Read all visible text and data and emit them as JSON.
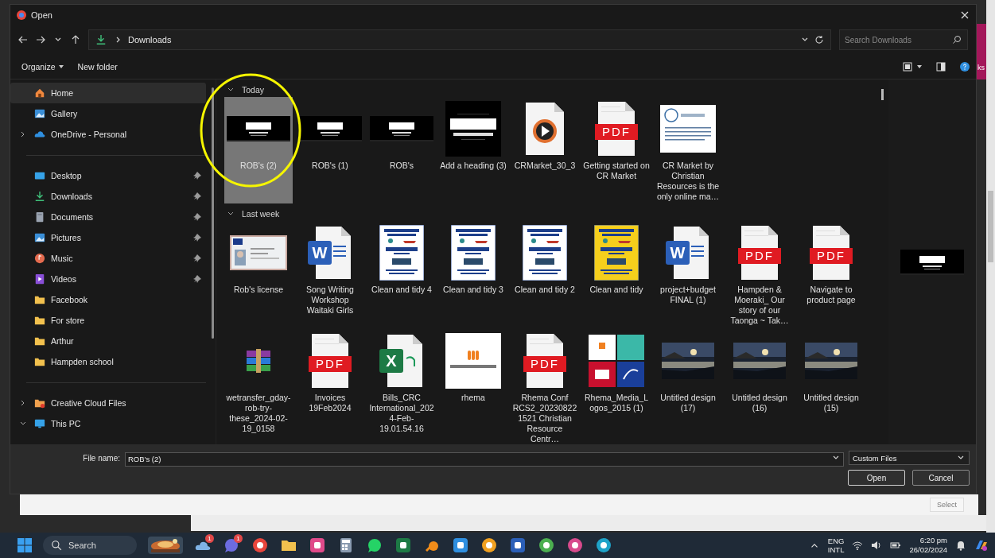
{
  "background_window": {
    "side_text": "ks",
    "button": {
      "label": "Select",
      "disabled": true
    }
  },
  "dialog": {
    "title": "Open",
    "nav": {
      "path": [
        "Downloads"
      ],
      "search": {
        "placeholder": "Search Downloads"
      }
    },
    "toolbar": {
      "buttons": [
        {
          "label": "Organize",
          "menu": true
        },
        {
          "label": "New folder",
          "menu": false
        }
      ]
    },
    "sidebar": {
      "groups": [
        [
          {
            "label": "Home",
            "kind": "home",
            "expandable": false,
            "pinned": false,
            "selected": true
          },
          {
            "label": "Gallery",
            "kind": "gallery",
            "expandable": false,
            "pinned": false,
            "selected": false
          },
          {
            "label": "OneDrive - Personal",
            "kind": "cloud",
            "expandable": true,
            "expanded": false,
            "pinned": false,
            "selected": false
          }
        ],
        [
          {
            "label": "Desktop",
            "kind": "desktop",
            "expandable": false,
            "pinned": true,
            "selected": false
          },
          {
            "label": "Downloads",
            "kind": "download",
            "expandable": false,
            "pinned": true,
            "selected": false
          },
          {
            "label": "Documents",
            "kind": "document",
            "expandable": false,
            "pinned": true,
            "selected": false
          },
          {
            "label": "Pictures",
            "kind": "gallery",
            "expandable": false,
            "pinned": true,
            "selected": false
          },
          {
            "label": "Music",
            "kind": "music",
            "expandable": false,
            "pinned": true,
            "selected": false
          },
          {
            "label": "Videos",
            "kind": "video",
            "expandable": false,
            "pinned": true,
            "selected": false
          },
          {
            "label": "Facebook",
            "kind": "folder",
            "expandable": false,
            "pinned": false,
            "selected": false
          },
          {
            "label": "For store",
            "kind": "folder",
            "expandable": false,
            "pinned": false,
            "selected": false
          },
          {
            "label": "Arthur",
            "kind": "folder",
            "expandable": false,
            "pinned": false,
            "selected": false
          },
          {
            "label": "Hampden school",
            "kind": "folder",
            "expandable": false,
            "pinned": false,
            "selected": false
          }
        ],
        [
          {
            "label": "Creative Cloud Files",
            "kind": "cc",
            "expandable": true,
            "expanded": false,
            "pinned": false,
            "selected": false
          },
          {
            "label": "This PC",
            "kind": "pc",
            "expandable": true,
            "expanded": true,
            "pinned": false,
            "selected": false
          }
        ]
      ]
    },
    "files": {
      "groups": [
        {
          "label": "Today",
          "expanded": true,
          "items": [
            {
              "name": "ROB's (2)",
              "kind": "banner",
              "selected": true
            },
            {
              "name": "ROB's (1)",
              "kind": "banner",
              "selected": false
            },
            {
              "name": "ROB's",
              "kind": "banner",
              "selected": false
            },
            {
              "name": "Add a heading (3)",
              "kind": "square-banner",
              "selected": false
            },
            {
              "name": "CRMarket_30_3",
              "kind": "video",
              "selected": false
            },
            {
              "name": "Getting started on CR Market",
              "kind": "pdf",
              "icon_text": "PDF",
              "selected": false
            },
            {
              "name": "CR Market by Christian Resources is the only online ma…",
              "kind": "page",
              "selected": false
            }
          ]
        },
        {
          "label": "Last week",
          "expanded": true,
          "items": [
            {
              "name": "Rob's license",
              "kind": "card",
              "selected": false
            },
            {
              "name": "Song Writing Workshop Waitaki Girls",
              "kind": "word",
              "icon_text": "W",
              "selected": false
            },
            {
              "name": "Clean and tidy 4",
              "kind": "poster",
              "color": "#ffffff",
              "selected": false
            },
            {
              "name": "Clean and tidy 3",
              "kind": "poster",
              "color": "#ffffff",
              "selected": false
            },
            {
              "name": "Clean and tidy 2",
              "kind": "poster",
              "color": "#ffffff",
              "selected": false
            },
            {
              "name": "Clean and tidy",
              "kind": "poster",
              "color": "#f5cf1c",
              "selected": false
            },
            {
              "name": "project+budget FINAL (1)",
              "kind": "word",
              "icon_text": "W",
              "selected": false
            },
            {
              "name": "Hampden & Moeraki_ Our story of our Taonga ~ Tak…",
              "kind": "pdf",
              "icon_text": "PDF",
              "selected": false
            },
            {
              "name": "Navigate to product page",
              "kind": "pdf",
              "icon_text": "PDF",
              "selected": false
            },
            {
              "name": "wetransfer_gday-rob-try-these_2024-02-19_0158",
              "kind": "archive",
              "selected": false
            },
            {
              "name": "Invoices 19Feb2024",
              "kind": "pdf",
              "icon_text": "PDF",
              "selected": false
            },
            {
              "name": "Bills_CRC International_2024-Feb-19.01.54.16",
              "kind": "excel",
              "icon_text": "X",
              "selected": false
            },
            {
              "name": "rhema",
              "kind": "logo",
              "selected": false
            },
            {
              "name": "Rhema Conf RCS2_202308221521 Christian Resource Centr…",
              "kind": "pdf",
              "icon_text": "PDF",
              "selected": false
            },
            {
              "name": "Rhema_Media_Logos_2015 (1)",
              "kind": "collage",
              "selected": false
            },
            {
              "name": "Untitled design (17)",
              "kind": "landscape",
              "selected": false
            },
            {
              "name": "Untitled design (16)",
              "kind": "landscape",
              "selected": false
            },
            {
              "name": "Untitled design (15)",
              "kind": "landscape",
              "selected": false
            }
          ]
        }
      ]
    },
    "preview": {
      "kind": "banner"
    },
    "footer": {
      "file_name_label": "File name:",
      "file_name": "ROB's (2)",
      "filter": "Custom Files",
      "buttons": [
        "Open",
        "Cancel"
      ]
    }
  },
  "taskbar": {
    "search": "Search",
    "apps": [
      {
        "kind": "cloud",
        "color": "#7fb3e6",
        "badge": "1"
      },
      {
        "kind": "chat",
        "color": "#6c6ce0",
        "badge": "1"
      },
      {
        "kind": "ring",
        "color": "#e8453c"
      },
      {
        "kind": "folder",
        "color": "#f2c14e"
      },
      {
        "kind": "tile",
        "color": "#e04a8a"
      },
      {
        "kind": "calculator",
        "color": "#8a9bb0"
      },
      {
        "kind": "chat",
        "color": "#25d366"
      },
      {
        "kind": "tile",
        "color": "#1d7a45"
      },
      {
        "kind": "swirl",
        "color": "#f08c1a"
      },
      {
        "kind": "tile",
        "color": "#2f8fe0"
      },
      {
        "kind": "ring",
        "color": "#f0a020"
      },
      {
        "kind": "tile",
        "color": "#2b5fb8"
      },
      {
        "kind": "ring",
        "color": "#4caf50"
      },
      {
        "kind": "ring",
        "color": "#d84a8c"
      },
      {
        "kind": "ring",
        "color": "#1fa3c8"
      }
    ],
    "language": [
      "ENG",
      "INTL"
    ],
    "time": "6:20 pm",
    "date": "26/02/2024"
  }
}
